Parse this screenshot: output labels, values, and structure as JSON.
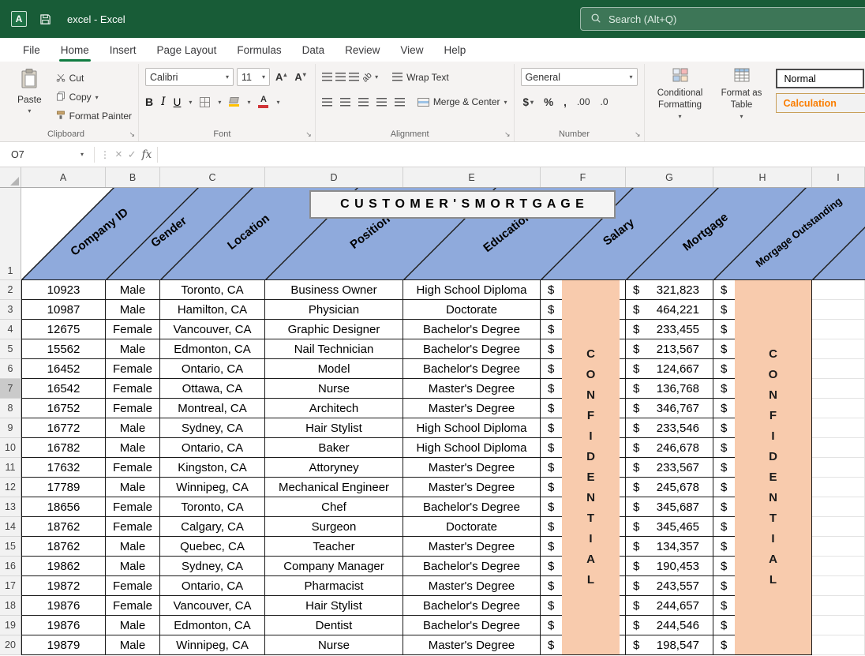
{
  "titlebar": {
    "app_name": "excel - Excel",
    "search_placeholder": "Search (Alt+Q)"
  },
  "menu": {
    "tabs": [
      "File",
      "Home",
      "Insert",
      "Page Layout",
      "Formulas",
      "Data",
      "Review",
      "View",
      "Help"
    ],
    "active_tab": "Home"
  },
  "ribbon": {
    "clipboard": {
      "label": "Clipboard",
      "paste": "Paste",
      "cut": "Cut",
      "copy": "Copy",
      "format_painter": "Format Painter"
    },
    "font": {
      "label": "Font",
      "font_name": "Calibri",
      "font_size": "11",
      "bold": "B",
      "italic": "I",
      "underline": "U",
      "letter": "A"
    },
    "alignment": {
      "label": "Alignment",
      "wrap_text": "Wrap Text",
      "merge_center": "Merge & Center",
      "orient_text": "ab"
    },
    "number": {
      "label": "Number",
      "format": "General",
      "accounting": "$",
      "percent": "%",
      "comma": ",",
      "inc_decimal": ".00",
      "dec_decimal": ".0"
    },
    "styles": {
      "conditional_formatting": "Conditional Formatting",
      "format_as_table": "Format as Table",
      "cell_styles": [
        "Normal",
        "Calculation"
      ]
    }
  },
  "formula_bar": {
    "name_box": "O7",
    "fx": "fx"
  },
  "sheet": {
    "columns": [
      "A",
      "B",
      "C",
      "D",
      "E",
      "F",
      "G",
      "H",
      "I"
    ],
    "header_row_number": "1",
    "selected_row": 7,
    "title": "C U S T O M E R ' S   M O R T G A G E",
    "diagonal_headers": [
      "Company ID",
      "Gender",
      "Location",
      "Position",
      "Education",
      "Salary",
      "Mortgage",
      "Morgage Outstanding"
    ],
    "confidential": "CONFIDENTIAL",
    "currency": "$",
    "row_fields": [
      "company_id",
      "gender",
      "location",
      "position",
      "education",
      "mortgage"
    ],
    "rows": [
      [
        "10923",
        "Male",
        "Toronto, CA",
        "Business Owner",
        "High School Diploma",
        "321,823"
      ],
      [
        "10987",
        "Male",
        "Hamilton, CA",
        "Physician",
        "Doctorate",
        "464,221"
      ],
      [
        "12675",
        "Female",
        "Vancouver, CA",
        "Graphic Designer",
        "Bachelor's Degree",
        "233,455"
      ],
      [
        "15562",
        "Male",
        "Edmonton, CA",
        "Nail Technician",
        "Bachelor's Degree",
        "213,567"
      ],
      [
        "16452",
        "Female",
        "Ontario, CA",
        "Model",
        "Bachelor's Degree",
        "124,667"
      ],
      [
        "16542",
        "Female",
        "Ottawa, CA",
        "Nurse",
        "Master's Degree",
        "136,768"
      ],
      [
        "16752",
        "Female",
        "Montreal, CA",
        "Architech",
        "Master's Degree",
        "346,767"
      ],
      [
        "16772",
        "Male",
        "Sydney, CA",
        "Hair Stylist",
        "High School Diploma",
        "233,546"
      ],
      [
        "16782",
        "Male",
        "Ontario, CA",
        "Baker",
        "High School Diploma",
        "246,678"
      ],
      [
        "17632",
        "Female",
        "Kingston, CA",
        "Attoryney",
        "Master's Degree",
        "233,567"
      ],
      [
        "17789",
        "Male",
        "Winnipeg, CA",
        "Mechanical Engineer",
        "Master's Degree",
        "245,678"
      ],
      [
        "18656",
        "Female",
        "Toronto, CA",
        "Chef",
        "Bachelor's Degree",
        "345,687"
      ],
      [
        "18762",
        "Female",
        "Calgary, CA",
        "Surgeon",
        "Doctorate",
        "345,465"
      ],
      [
        "18762",
        "Male",
        "Quebec, CA",
        "Teacher",
        "Master's Degree",
        "134,357"
      ],
      [
        "19862",
        "Male",
        "Sydney, CA",
        "Company Manager",
        "Bachelor's Degree",
        "190,453"
      ],
      [
        "19872",
        "Female",
        "Ontario, CA",
        "Pharmacist",
        "Master's Degree",
        "243,557"
      ],
      [
        "19876",
        "Female",
        "Vancouver, CA",
        "Hair Stylist",
        "Bachelor's Degree",
        "244,657"
      ],
      [
        "19876",
        "Male",
        "Edmonton, CA",
        "Dentist",
        "Bachelor's Degree",
        "244,546"
      ],
      [
        "19879",
        "Male",
        "Winnipeg, CA",
        "Nurse",
        "Master's Degree",
        "198,547"
      ]
    ]
  },
  "icons": {
    "caret": "▾",
    "caret_up": "▴",
    "launcher": "↘",
    "kebab": "⋮",
    "close": "×",
    "check": "✓"
  },
  "colors": {
    "titlebar_green": "#185C37",
    "accent_green": "#107C41",
    "header_blue": "#8FAADC",
    "confidential_fill": "#F8CBAD",
    "calculation_text": "#FA7D00"
  }
}
